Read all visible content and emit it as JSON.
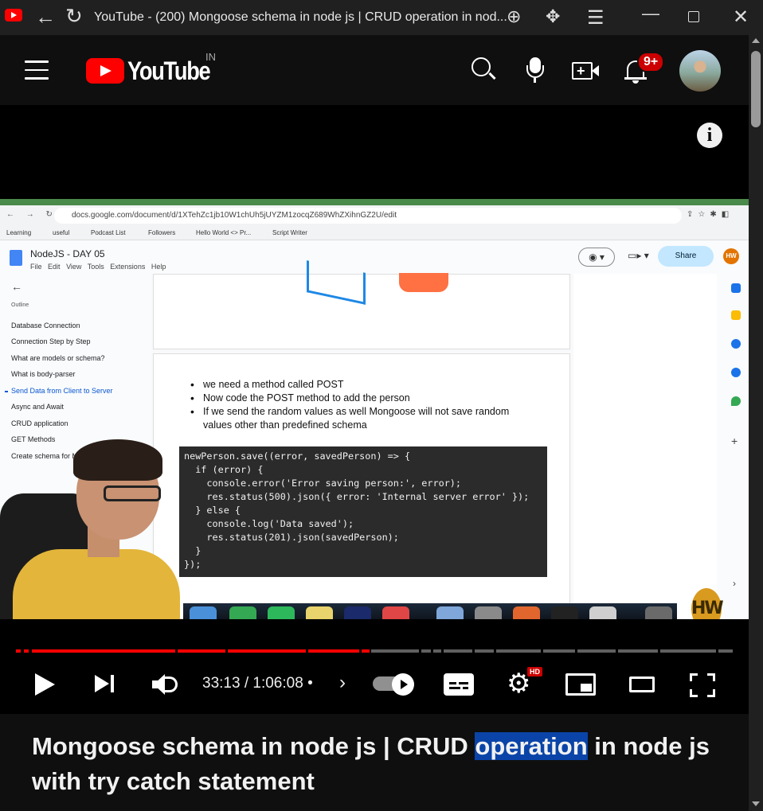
{
  "browser": {
    "tab_title": "YouTube - (200) Mongoose schema in node js | CRUD operation in nod..."
  },
  "youtube_header": {
    "logo_text": "YouTube",
    "country_code": "IN",
    "notification_count": "9+"
  },
  "video_frame": {
    "url": "docs.google.com/document/d/1XTehZc1jb10W1chUh5jUYZM1zocqZ689WhZXihnGZ2U/edit",
    "bookmarks": [
      "Learning",
      "useful",
      "Podcast List",
      "Followers",
      "Hello World <> Pr...",
      "Script Writer"
    ],
    "doc_title": "NodeJS - DAY 05",
    "doc_menu": [
      "File",
      "Edit",
      "View",
      "Tools",
      "Extensions",
      "Help"
    ],
    "share_label": "Share",
    "avatar_initials": "HW",
    "outline_title": "Outline",
    "outline_items": [
      "Database Connection",
      "Connection Step by Step",
      "What are models or schema?",
      "What is body-parser",
      "Send Data from Client to Server",
      "Async and Await",
      "CRUD application",
      "GET Methods",
      "Create schema for M"
    ],
    "bullets": [
      "we need a method called POST",
      "Now code the POST method to add the person",
      "If we send the random values as well Mongoose will not save random values other than predefined schema"
    ],
    "code_lines": [
      "newPerson.save((error, savedPerson) => {",
      "  if (error) {",
      "    console.error('Error saving person:', error);",
      "    res.status(500).json({ error: 'Internal server error' });",
      "  } else {",
      "    console.log('Data saved');",
      "    res.status(201).json(savedPerson);",
      "  }",
      "});"
    ],
    "watermark": "HW"
  },
  "player": {
    "time_display": "33:13 / 1:06:08",
    "separator": "•",
    "progress_fraction": 0.5,
    "quality_badge": "HD"
  },
  "video_title": {
    "before": "Mongoose schema in node js | CRUD ",
    "highlighted": "operation",
    "after": " in node js with try catch statement"
  },
  "colors": {
    "youtube_red": "#ff0000",
    "progress_played": "#ff0000",
    "selection": "#0a44a8",
    "background": "#0f0f0f"
  }
}
